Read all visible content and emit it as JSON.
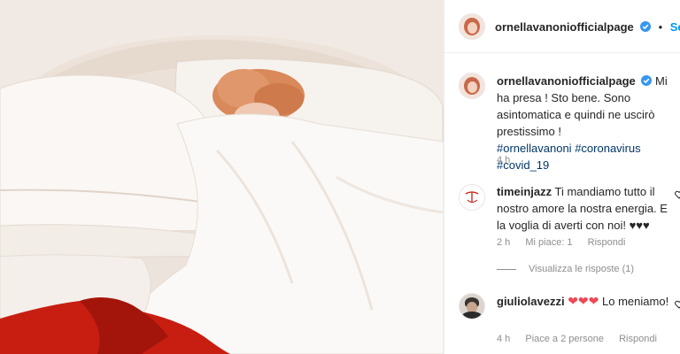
{
  "post": {
    "image_alt": "Woman sleeping in white bed with red blanket"
  },
  "header": {
    "username": "ornellavanoniofficialpage",
    "follow_label": "Segui"
  },
  "caption": {
    "username": "ornellavanoniofficialpage",
    "text": "Mi ha presa ! Sto bene. Sono asintomatica e quindi ne uscirò prestissimo !",
    "hashtags": [
      "#ornellavanoni",
      "#coronavirus",
      "#covid_19"
    ],
    "time": "4 h"
  },
  "comments": [
    {
      "username": "timeinjazz",
      "text": "Ti mandiamo tutto il nostro amore la nostra energia. E la voglia di averti con noi! ♥♥♥",
      "time": "2 h",
      "likes": "Mi piace: 1",
      "reply_label": "Rispondi",
      "view_replies": "Visualizza le risposte (1)"
    },
    {
      "username": "giuliolavezzi",
      "text": "Lo meniamo!",
      "emoji": "❤❤❤",
      "time": "4 h",
      "likes": "Piace a 2 persone",
      "reply_label": "Rispondi"
    }
  ],
  "colors": {
    "link": "#0095f6",
    "hashtag": "#00376b",
    "muted": "#8e8e8e",
    "blanket": "#c81e12"
  }
}
